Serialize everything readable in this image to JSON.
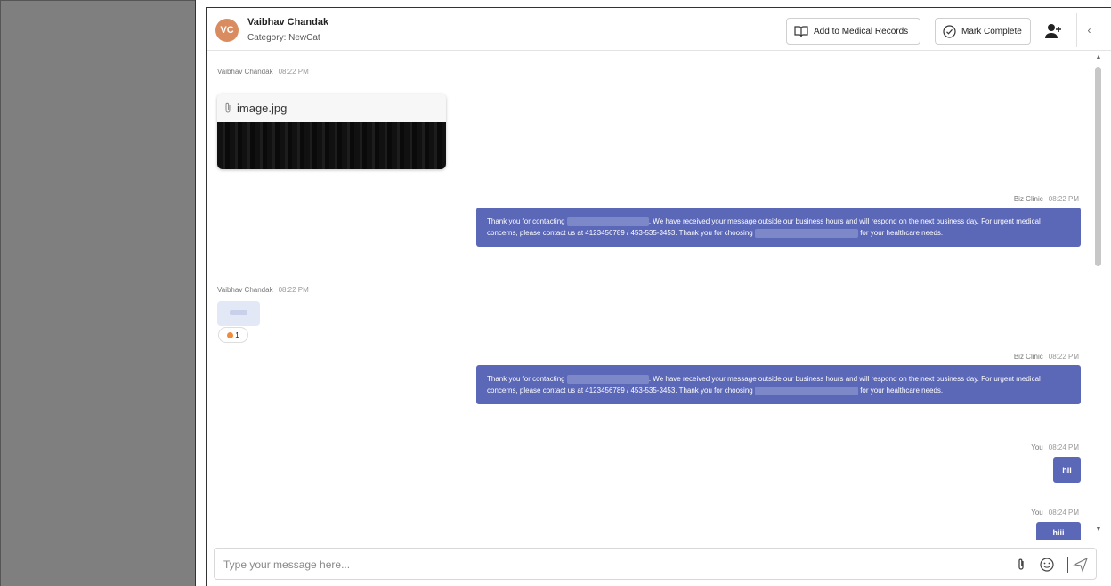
{
  "header": {
    "avatar_initials": "VC",
    "contact_name": "Vaibhav Chandak",
    "category": "Category: NewCat",
    "add_records_label": "Add to Medical Records",
    "mark_complete_label": "Mark Complete"
  },
  "messages": [
    {
      "sender": "Vaibhav Chandak",
      "time": "08:22 PM",
      "type": "file",
      "file_name": "image.jpg"
    },
    {
      "sender": "Biz Clinic",
      "time": "08:22 PM",
      "type": "text",
      "text_1": "Thank you for contacting",
      "text_2": ". We have received your message outside our business hours and will respond on the next business day. For urgent medical concerns, please contact us at 4123456789 / 453-535-3453. Thank you for choosing",
      "text_3": "for your healthcare needs."
    },
    {
      "sender": "Vaibhav Chandak",
      "time": "08:22 PM",
      "type": "emoji",
      "reaction_count": "1"
    },
    {
      "sender": "Biz Clinic",
      "time": "08:22 PM",
      "type": "text",
      "text_1": "Thank you for contacting",
      "text_2": ". We have received your message outside our business hours and will respond on the next business day. For urgent medical concerns, please contact us at 4123456789 / 453-535-3453. Thank you for choosing",
      "text_3": "for your healthcare needs."
    },
    {
      "sender": "You",
      "time": "08:24 PM",
      "type": "text",
      "text": "hii"
    },
    {
      "sender": "You",
      "time": "08:24 PM",
      "type": "text",
      "text": "hiii"
    }
  ],
  "composer": {
    "placeholder": "Type your message here..."
  },
  "colors": {
    "bubble": "#5b67b7",
    "avatar": "#d98c5f",
    "sidebar": "#7f7f7f"
  }
}
